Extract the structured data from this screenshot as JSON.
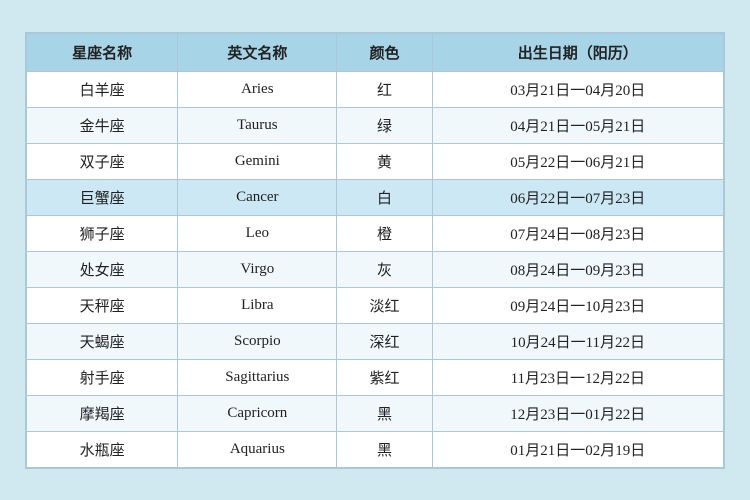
{
  "table": {
    "headers": [
      "星座名称",
      "英文名称",
      "颜色",
      "出生日期（阳历）"
    ],
    "rows": [
      {
        "chinese": "白羊座",
        "english": "Aries",
        "color": "红",
        "dates": "03月21日一04月20日"
      },
      {
        "chinese": "金牛座",
        "english": "Taurus",
        "color": "绿",
        "dates": "04月21日一05月21日"
      },
      {
        "chinese": "双子座",
        "english": "Gemini",
        "color": "黄",
        "dates": "05月22日一06月21日"
      },
      {
        "chinese": "巨蟹座",
        "english": "Cancer",
        "color": "白",
        "dates": "06月22日一07月23日"
      },
      {
        "chinese": "狮子座",
        "english": "Leo",
        "color": "橙",
        "dates": "07月24日一08月23日"
      },
      {
        "chinese": "处女座",
        "english": "Virgo",
        "color": "灰",
        "dates": "08月24日一09月23日"
      },
      {
        "chinese": "天秤座",
        "english": "Libra",
        "color": "淡红",
        "dates": "09月24日一10月23日"
      },
      {
        "chinese": "天蝎座",
        "english": "Scorpio",
        "color": "深红",
        "dates": "10月24日一11月22日"
      },
      {
        "chinese": "射手座",
        "english": "Sagittarius",
        "color": "紫红",
        "dates": "11月23日一12月22日"
      },
      {
        "chinese": "摩羯座",
        "english": "Capricorn",
        "color": "黑",
        "dates": "12月23日一01月22日"
      },
      {
        "chinese": "水瓶座",
        "english": "Aquarius",
        "color": "黑",
        "dates": "01月21日一02月19日"
      }
    ]
  }
}
